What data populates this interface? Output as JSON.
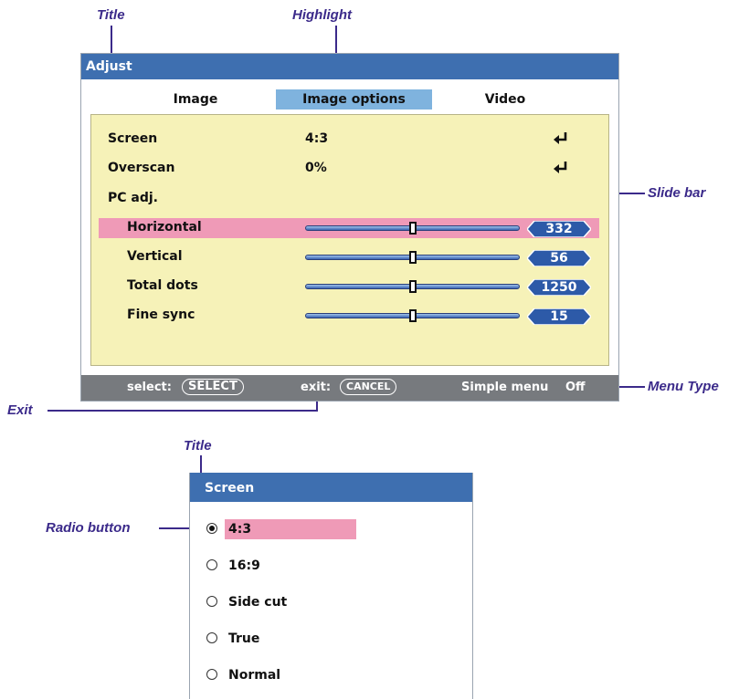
{
  "callouts": {
    "title_top": "Title",
    "highlight": "Highlight",
    "slide_bar": "Slide bar",
    "menu_type": "Menu Type",
    "exit": "Exit",
    "title_bottom": "Title",
    "radio_button": "Radio button"
  },
  "adjust": {
    "title": "Adjust",
    "tabs": [
      {
        "label": "Image"
      },
      {
        "label": "Image options",
        "active": true
      },
      {
        "label": "Video"
      }
    ],
    "rows": [
      {
        "label": "Screen",
        "value": "4:3",
        "icon": "enter-icon"
      },
      {
        "label": "Overscan",
        "value": "0%",
        "icon": "enter-icon"
      },
      {
        "label": "PC adj."
      }
    ],
    "sliders": [
      {
        "label": "Horizontal",
        "value": "332",
        "level": 0.5,
        "highlighted": true
      },
      {
        "label": "Vertical",
        "value": "56",
        "level": 0.5
      },
      {
        "label": "Total dots",
        "value": "1250",
        "level": 0.5
      },
      {
        "label": "Fine sync",
        "value": "15",
        "level": 0.5
      }
    ],
    "footer": {
      "select_label": "select:",
      "select_key": "SELECT",
      "exit_label": "exit:",
      "exit_key": "CANCEL",
      "simple_menu_label": "Simple menu",
      "simple_menu_value": "Off"
    }
  },
  "screen": {
    "title": "Screen",
    "options": [
      {
        "label": "4:3",
        "checked": true
      },
      {
        "label": "16:9"
      },
      {
        "label": "Side cut"
      },
      {
        "label": "True"
      },
      {
        "label": "Normal"
      }
    ]
  },
  "colors": {
    "title_bar": "#3e6fb0",
    "highlight": "#ef9ab7",
    "tab_active": "#7fb3de",
    "panel": "#f6f2b8",
    "footer": "#777a7e",
    "callout": "#3b2a8a"
  }
}
